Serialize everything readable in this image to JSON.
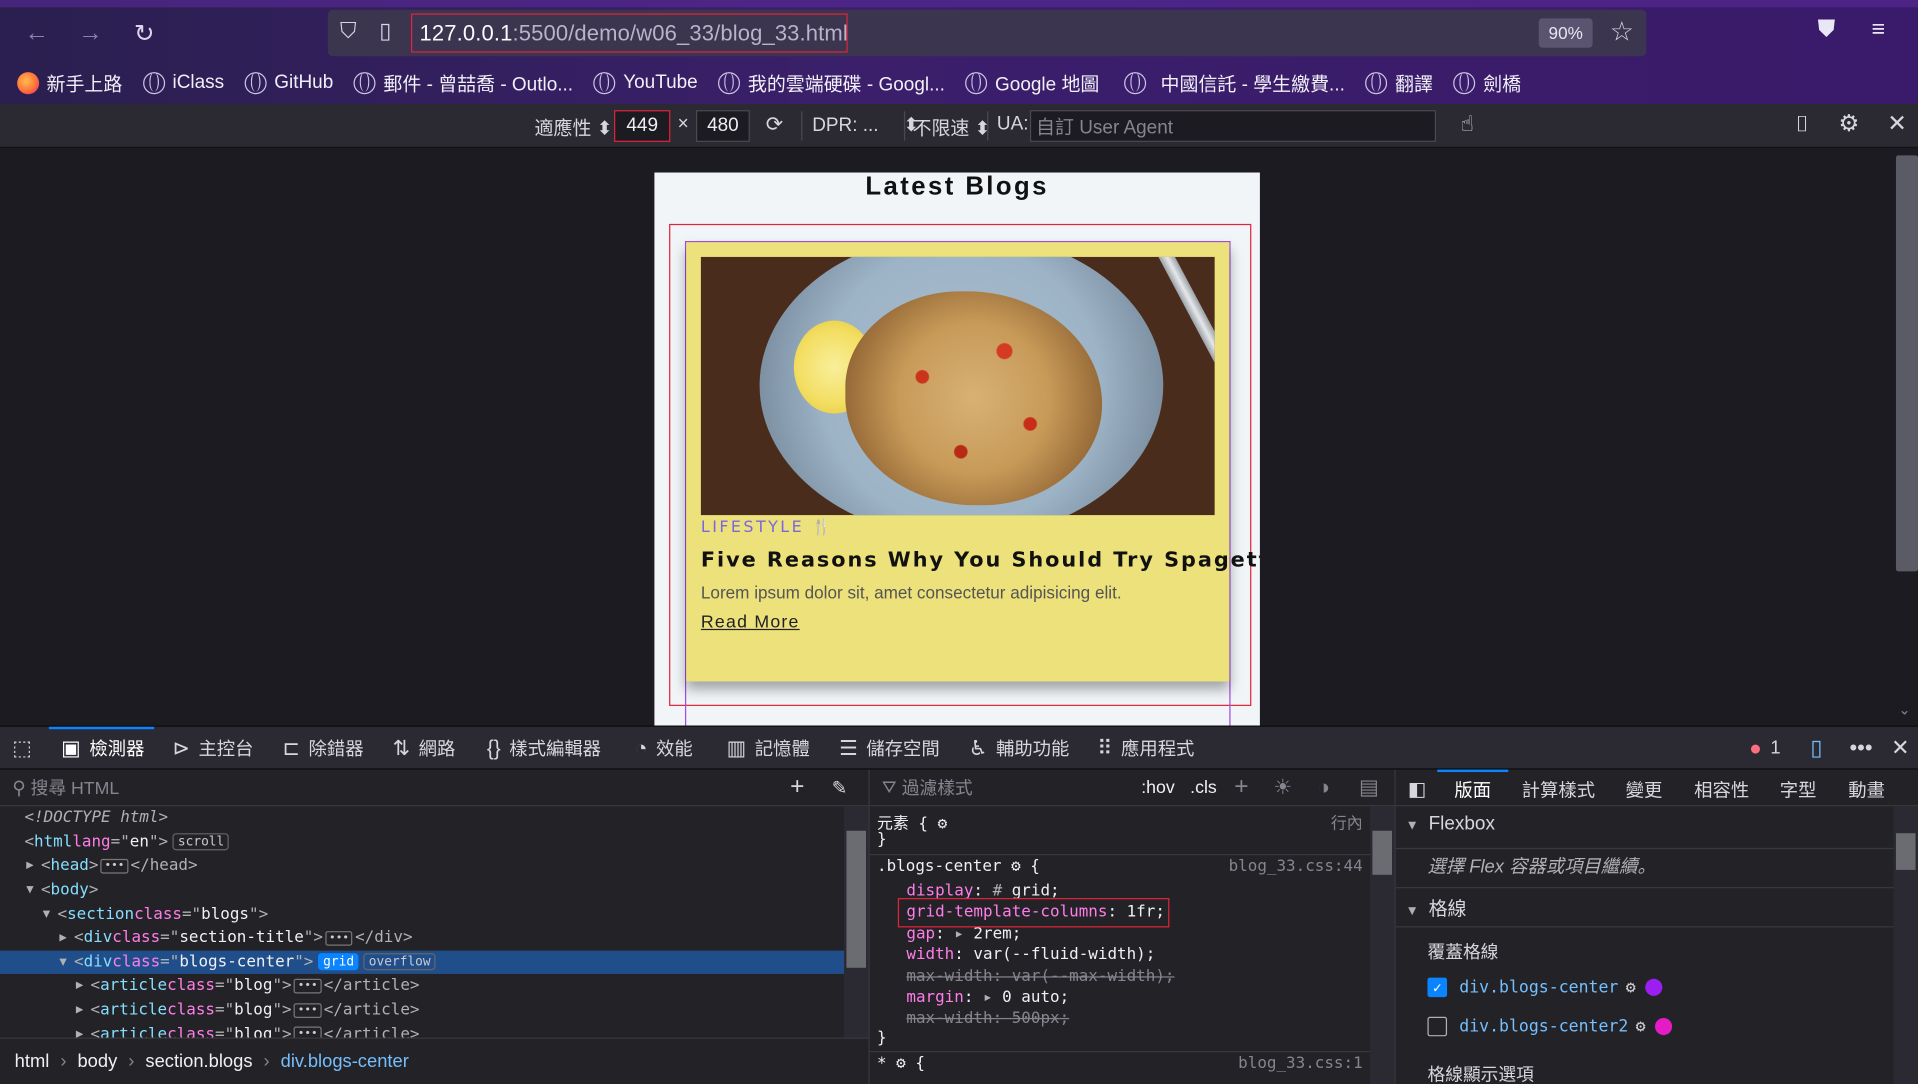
{
  "browser": {
    "url_host": "127.0.0.1",
    "url_path": ":5500/demo/w06_33/blog_33.html",
    "zoom": "90%"
  },
  "bookmarks": [
    "新手上路",
    "iClass",
    "GitHub",
    "郵件 - 曾喆喬 - Outlo...",
    "YouTube",
    "我的雲端硬碟 - Googl...",
    "Google 地圖",
    "中國信託 - 學生繳費...",
    "翻譯",
    "劍橋"
  ],
  "rdm": {
    "preset": "適應性",
    "width": "449",
    "times": "×",
    "height": "480",
    "dpr": "DPR: ...",
    "throttle": "不限速",
    "ua_label": "UA:",
    "ua_placeholder": "自訂 User Agent"
  },
  "page": {
    "title": "Latest Blogs",
    "card": {
      "category": "LIFESTYLE",
      "category_icon": "🍴",
      "title": "Five Reasons Why You Should Try Spagetti",
      "description": "Lorem ipsum dolor sit, amet consectetur adipisicing elit.",
      "link": "Read More"
    }
  },
  "devtools": {
    "tabs": [
      "檢測器",
      "主控台",
      "除錯器",
      "網路",
      "樣式編輯器",
      "效能",
      "記憶體",
      "儲存空間",
      "輔助功能",
      "應用程式"
    ],
    "error_count": "1",
    "html_search_placeholder": "搜尋 HTML",
    "tree": [
      {
        "indent": 0,
        "twisty": "",
        "text": "<!DOCTYPE html>",
        "kind": "doctype"
      },
      {
        "indent": 0,
        "twisty": "",
        "tag": "html",
        "attr": "lang",
        "val": "en",
        "badge": "scroll"
      },
      {
        "indent": 1,
        "twisty": "▶",
        "tag": "head",
        "collapsed": true,
        "close": "</head>"
      },
      {
        "indent": 1,
        "twisty": "▼",
        "tag": "body"
      },
      {
        "indent": 2,
        "twisty": "▼",
        "tag": "section",
        "attr": "class",
        "val": "blogs"
      },
      {
        "indent": 3,
        "twisty": "▶",
        "tag": "div",
        "attr": "class",
        "val": "section-title",
        "collapsed": true,
        "close": "</div>"
      },
      {
        "indent": 3,
        "twisty": "▼",
        "tag": "div",
        "attr": "class",
        "val": "blogs-center",
        "badge_blue": "grid",
        "badge": "overflow",
        "selected": true
      },
      {
        "indent": 4,
        "twisty": "▶",
        "tag": "article",
        "attr": "class",
        "val": "blog",
        "collapsed": true,
        "close": "</article>"
      },
      {
        "indent": 4,
        "twisty": "▶",
        "tag": "article",
        "attr": "class",
        "val": "blog",
        "collapsed": true,
        "close": "</article>"
      },
      {
        "indent": 4,
        "twisty": "▶",
        "tag": "article",
        "attr": "class",
        "val": "blog",
        "collapsed": true,
        "close": "</article>"
      }
    ],
    "breadcrumbs": [
      "html",
      "body",
      "section.blogs",
      "div.blogs-center"
    ],
    "rules_filter_placeholder": "過濾樣式",
    "rules_buttons": [
      ":hov",
      ".cls"
    ],
    "rules": {
      "element_selector": "元素 {",
      "element_close": "}",
      "inline_label": "行內",
      "selector": ".blogs-center",
      "source": "blog_33.css:44",
      "props": [
        {
          "name": "display",
          "value": "grid",
          "struck": false
        },
        {
          "name": "grid-template-columns",
          "value": "1fr",
          "struck": false
        },
        {
          "name": "gap",
          "value": "2rem",
          "struck": false
        },
        {
          "name": "width",
          "value": "var(--fluid-width)",
          "struck": false
        },
        {
          "name": "max-width",
          "value": "var(--max-width)",
          "struck": true
        },
        {
          "name": "margin",
          "value": "0 auto",
          "struck": false
        },
        {
          "name": "max-width",
          "value": "500px",
          "struck": true
        }
      ],
      "close": "}",
      "next_selector": "*",
      "next_source": "blog_33.css:1"
    },
    "side_tabs": [
      "版面",
      "計算樣式",
      "變更",
      "相容性",
      "字型",
      "動畫"
    ],
    "layout": {
      "flexbox_header": "Flexbox",
      "flexbox_note": "選擇 Flex 容器或項目繼續。",
      "grid_header": "格線",
      "overlay_header": "覆蓋格線",
      "overlays": [
        {
          "label": "div.blogs-center",
          "checked": true,
          "color": "#9b1ff3"
        },
        {
          "label": "div.blogs-center2",
          "checked": false,
          "color": "#e51bc6"
        }
      ],
      "display_options": "格線顯示選項"
    }
  }
}
